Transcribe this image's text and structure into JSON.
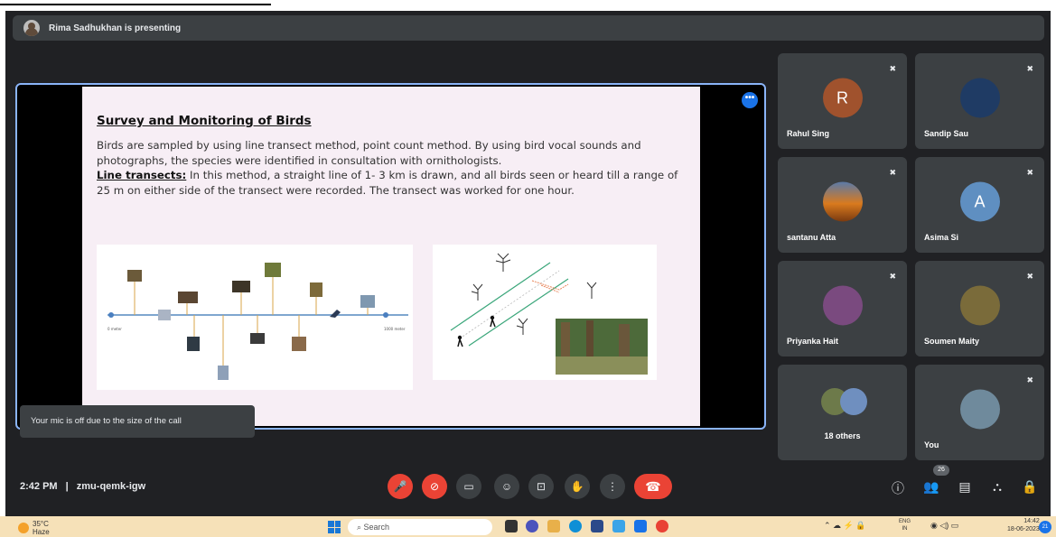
{
  "presenter_bar": {
    "text": "Rima Sadhukhan is presenting"
  },
  "slide": {
    "title": "Survey and Monitoring of Birds",
    "para1": "Birds are sampled by using line transect method, point count method. By using bird vocal sounds and photographs, the species were identified in consultation with ornithologists.",
    "line_label": "Line transects:",
    "para2": " In this method, a straight line of 1- 3 km is drawn, and all birds seen or heard till a range of 25 m on either side of the transect were recorded. The transect was worked for one hour.",
    "axis_left": "0 meter",
    "axis_right": "1000 meter"
  },
  "toast": {
    "text": "Your mic is off due to the size of the call"
  },
  "participants": [
    {
      "name": "Rahul Sing",
      "initial": "R",
      "color": "#a0522d"
    },
    {
      "name": "Sandip Sau",
      "initial": "",
      "color": "#1f3b64"
    },
    {
      "name": "santanu Atta",
      "initial": "",
      "color": "#d97a1e"
    },
    {
      "name": "Asima Si",
      "initial": "A",
      "color": "#5f8fc1"
    },
    {
      "name": "Priyanka Hait",
      "initial": "",
      "color": "#7a4a7f"
    },
    {
      "name": "Soumen Maity",
      "initial": "",
      "color": "#7a6b3a"
    },
    {
      "name": "18 others",
      "initial": "",
      "color": "#6d7a4a"
    },
    {
      "name": "You",
      "initial": "",
      "color": "#6f8a9c"
    }
  ],
  "meeting": {
    "time": "2:42 PM",
    "separator": "|",
    "code": "zmu-qemk-igw",
    "people_count": "26"
  },
  "taskbar": {
    "temp": "35°C",
    "weather_sub": "Haze",
    "search_placeholder": "Search",
    "lang": "ENG",
    "lang_sub": "IN",
    "time": "14:42",
    "date": "18-06-2023",
    "notif_count": "21"
  }
}
